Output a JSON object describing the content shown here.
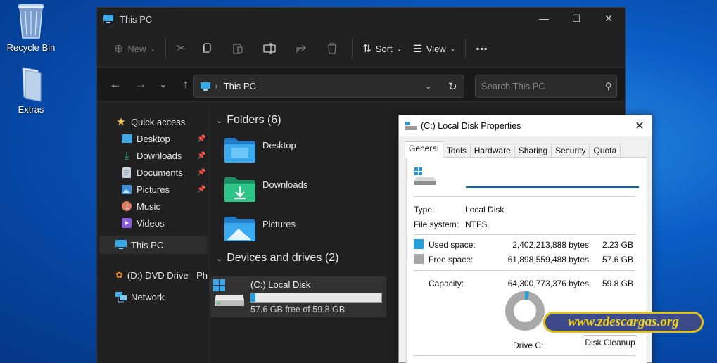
{
  "desktop": {
    "icons": [
      {
        "label": "Recycle Bin",
        "icon": "recycle-bin-icon"
      },
      {
        "label": "Extras",
        "icon": "folder-icon"
      }
    ]
  },
  "explorer": {
    "title": "This PC",
    "toolbar": {
      "new_label": "New",
      "sort_label": "Sort",
      "view_label": "View",
      "more_label": "..."
    },
    "address": "This PC",
    "search_placeholder": "Search This PC",
    "sidebar": {
      "quick_access": "Quick access",
      "items": [
        {
          "label": "Desktop",
          "pinned": true
        },
        {
          "label": "Downloads",
          "pinned": true
        },
        {
          "label": "Documents",
          "pinned": true
        },
        {
          "label": "Pictures",
          "pinned": true
        },
        {
          "label": "Music",
          "pinned": false
        },
        {
          "label": "Videos",
          "pinned": false
        }
      ],
      "this_pc": "This PC",
      "dvd": "(D:) DVD Drive - Phe",
      "network": "Network"
    },
    "folders_header": "Folders (6)",
    "folders": [
      "Desktop",
      "Downloads",
      "Pictures"
    ],
    "devices_header": "Devices and drives (2)",
    "drive": {
      "name": "(C:) Local Disk",
      "free_text": "57.6 GB free of 59.8 GB",
      "used_fraction": 0.037
    }
  },
  "dialog": {
    "title": "(C:) Local Disk Properties",
    "tabs": [
      "General",
      "Tools",
      "Hardware",
      "Sharing",
      "Security",
      "Quota"
    ],
    "active_tab": "General",
    "name_value": "",
    "type_label": "Type:",
    "type_value": "Local Disk",
    "fs_label": "File system:",
    "fs_value": "NTFS",
    "used_label": "Used space:",
    "used_bytes": "2,402,213,888 bytes",
    "used_gb": "2.23 GB",
    "free_label": "Free space:",
    "free_bytes": "61,898,559,488 bytes",
    "free_gb": "57.6 GB",
    "capacity_label": "Capacity:",
    "capacity_bytes": "64,300,773,376 bytes",
    "capacity_gb": "59.8 GB",
    "drive_label": "Drive C:",
    "cleanup_label": "Disk Cleanup",
    "used_fraction": 0.037,
    "colors": {
      "used": "#26a0da",
      "free": "#a9a9a9"
    }
  },
  "watermark": "www.zdescargas.org"
}
